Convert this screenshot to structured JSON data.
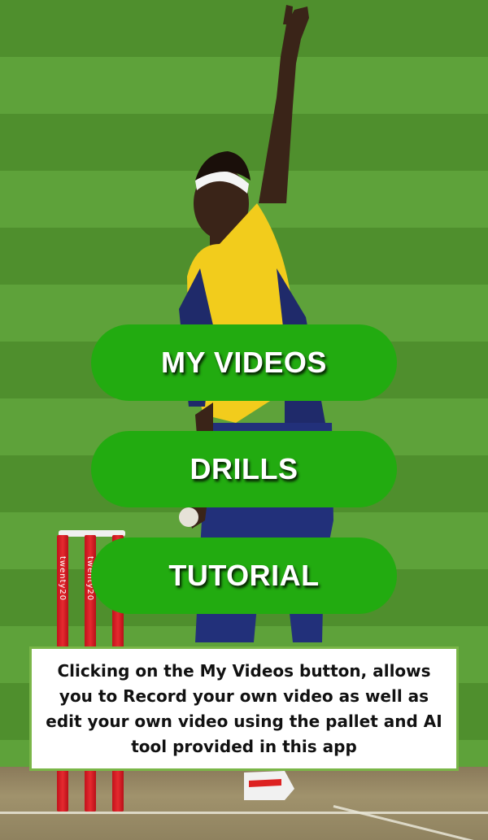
{
  "background": {
    "image_description_icon": "cricket-bowler-photo",
    "grass_dark": "#4f8f2d",
    "grass_light": "#5ea23a"
  },
  "stumps": {
    "text": "twenty20"
  },
  "menu": {
    "buttons": [
      {
        "id": "my-videos",
        "label": "MY VIDEOS"
      },
      {
        "id": "drills",
        "label": "DRILLS"
      },
      {
        "id": "tutorial",
        "label": "TUTORIAL"
      }
    ],
    "button_color": "#22ab10"
  },
  "info": {
    "text": "Clicking on the My Videos button, allows you to Record your own video as well as edit your own video using the pallet and AI tool provided in this app",
    "border_color": "#7ab648"
  }
}
